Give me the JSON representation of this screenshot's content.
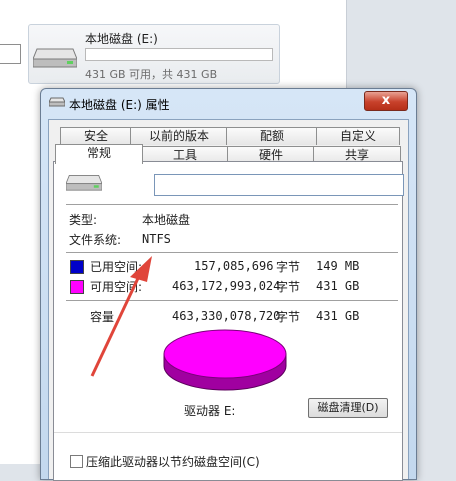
{
  "explorer": {
    "drive_name": "本地磁盘 (E:)",
    "drive_space": "431 GB 可用，共 431 GB"
  },
  "dialog": {
    "title": "本地磁盘 (E:) 属性",
    "close": "x",
    "tabs_top": [
      "安全",
      "以前的版本",
      "配额",
      "自定义"
    ],
    "tabs_bottom": [
      "常规",
      "工具",
      "硬件",
      "共享"
    ],
    "name_value": "",
    "type_label": "类型:",
    "type_value": "本地磁盘",
    "fs_label": "文件系统:",
    "fs_value": "NTFS",
    "used": {
      "label": "已用空间:",
      "bytes": "157,085,696",
      "unit": "字节",
      "size": "149 MB",
      "color": "#0000c8"
    },
    "free": {
      "label": "可用空间:",
      "bytes": "463,172,993,024",
      "unit": "字节",
      "size": "431 GB",
      "color": "#ff00ff"
    },
    "capacity": {
      "label": "容量",
      "bytes": "463,330,078,720",
      "unit": "字节",
      "size": "431 GB"
    },
    "drive_label": "驱动器 E:",
    "cleanup_button": "磁盘清理(D)",
    "compress_label": "压缩此驱动器以节约磁盘空间(C)"
  },
  "annotation": {
    "arrow_color": "#e0453a"
  }
}
